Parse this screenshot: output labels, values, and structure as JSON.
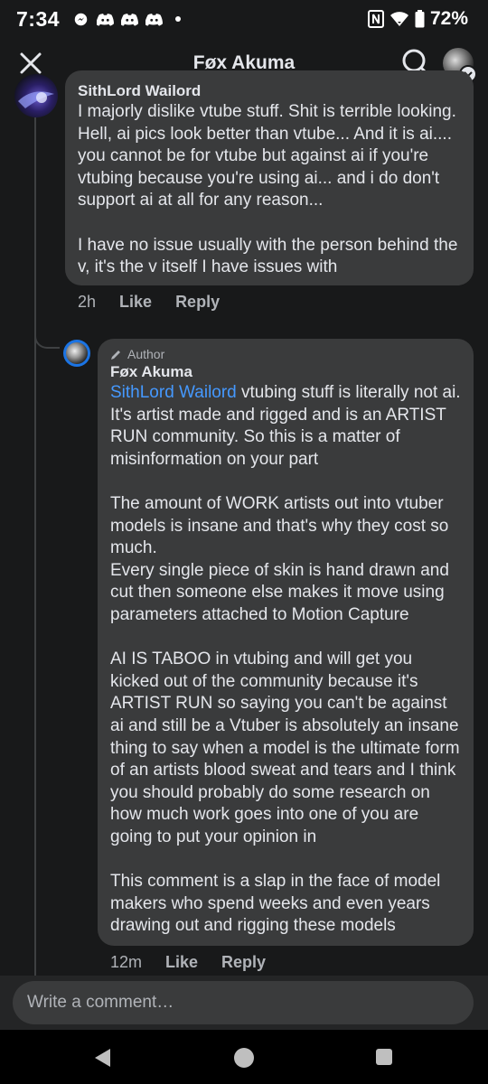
{
  "status_bar": {
    "time": "7:34",
    "battery": "72%",
    "icons": [
      "messenger-icon",
      "discord-icon",
      "discord-icon",
      "discord-icon",
      "notification-dot",
      "nfc-icon",
      "wifi-icon",
      "battery-icon"
    ]
  },
  "header": {
    "title": "Føx Akuma",
    "icons": [
      "close-icon",
      "search-icon",
      "avatar"
    ]
  },
  "comments": [
    {
      "author": "SithLord Wailord",
      "text": "I majorly dislike vtube stuff. Shit is terrible looking. Hell, ai pics look better than vtube... And it is ai.... you cannot be for vtube but against ai if you're vtubing because you're using ai... and i do don't support ai at all for any reason...\n\nI have no issue usually with the person behind the v, it's the v itself I have issues with",
      "time": "2h",
      "like_label": "Like",
      "reply_label": "Reply"
    },
    {
      "badge": "Author",
      "author": "Føx Akuma",
      "mention": "SithLord Wailord",
      "text": " vtubing stuff is literally not ai. It's artist made and rigged and is an ARTIST RUN community. So this is a matter of misinformation on your part\n\nThe amount of WORK artists out into vtuber models is insane and that's why they cost so much.\nEvery single piece of skin is hand drawn and cut then someone else makes it move using parameters attached to Motion Capture\n\nAI IS TABOO in vtubing and will get you kicked out of the community because it's ARTIST RUN so saying you can't be against ai and still be a Vtuber is absolutely an insane thing to say when a model is the ultimate form of an artists blood sweat and tears and I think you should probably do some research on how much work goes into one of you are going to put your opinion in\n\nThis comment is a slap in the face of model makers who spend weeks and even years drawing out and rigging these models",
      "time": "12m",
      "like_label": "Like",
      "reply_label": "Reply"
    }
  ],
  "composer": {
    "placeholder": "Write a comment…"
  },
  "navbar": {
    "icons": [
      "back-icon",
      "home-icon",
      "recents-icon"
    ]
  },
  "colors": {
    "background": "#18191a",
    "bubble": "#3a3b3c",
    "mention": "#4599ff",
    "avatar_ring": "#1b74e4"
  }
}
